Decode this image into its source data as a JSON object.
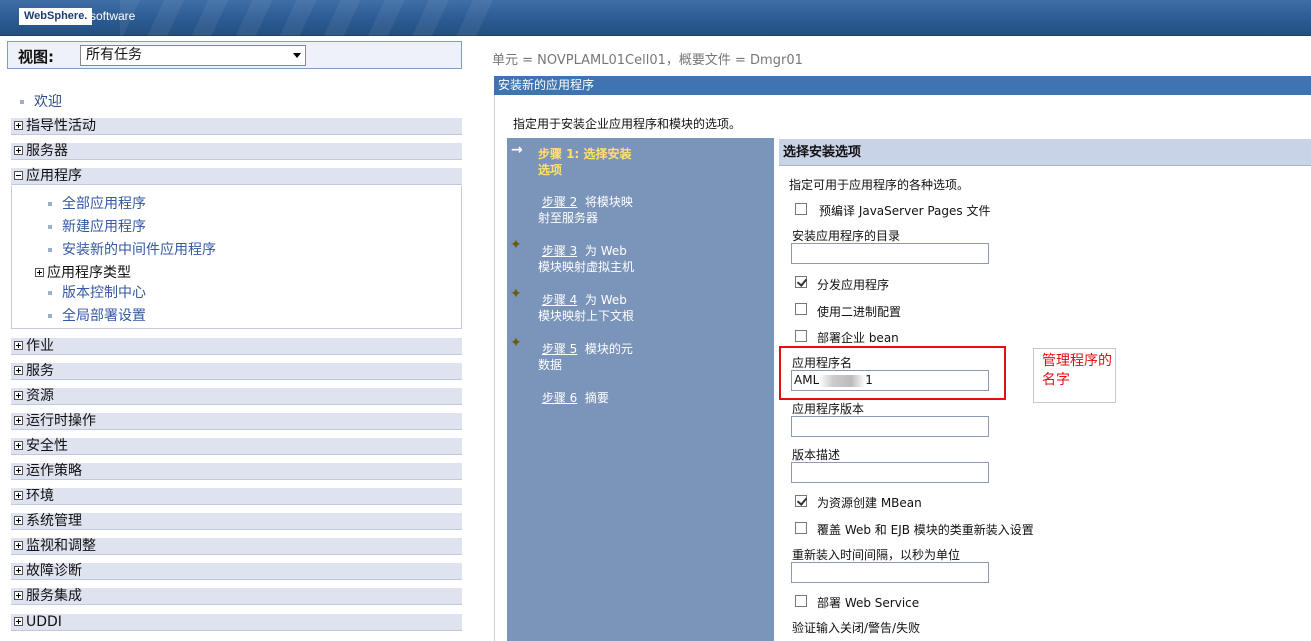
{
  "brand": {
    "logo": "WebSphere.",
    "sub": "software"
  },
  "nav": {
    "view_label": "视图:",
    "view_value": "所有任务",
    "welcome": "欢迎",
    "sections": {
      "guided": "指导性活动",
      "servers": "服务器",
      "applications": "应用程序",
      "jobs": "作业",
      "services": "服务",
      "resources": "资源",
      "runtime_ops": "运行时操作",
      "security": "安全性",
      "operational_policies": "运作策略",
      "environment": "环境",
      "system_admin": "系统管理",
      "monitoring": "监视和调整",
      "troubleshooting": "故障诊断",
      "service_integration": "服务集成",
      "uddi": "UDDI"
    },
    "app_children": {
      "all_apps": "全部应用程序",
      "new_app": "新建应用程序",
      "install_mw": "安装新的中间件应用程序",
      "app_types": "应用程序类型",
      "version_center": "版本控制中心",
      "global_deploy": "全局部署设置"
    }
  },
  "main": {
    "breadcrumb": "单元 = NOVPLAML01Cell01，概要文件 = Dmgr01",
    "panel_title": "安装新的应用程序",
    "intro": "指定用于安装企业应用程序和模块的选项。",
    "steps": {
      "s1": {
        "link": "步骤 1: 选择安装",
        "rest": "选项"
      },
      "s2": {
        "link": "步骤 2",
        "rest": "将模块映",
        "line2": "射至服务器"
      },
      "s3": {
        "link": "步骤 3",
        "rest": "为 Web",
        "line2": "模块映射虚拟主机"
      },
      "s4": {
        "link": "步骤 4",
        "rest": "为 Web",
        "line2": "模块映射上下文根"
      },
      "s5": {
        "link": "步骤 5",
        "rest": "模块的元",
        "line2": "数据"
      },
      "s6": {
        "link": "步骤 6",
        "rest": "摘要"
      }
    },
    "form": {
      "heading": "选择安装选项",
      "description": "指定可用于应用程序的各种选项。",
      "precompile_jsp": "预编译 JavaServer Pages 文件",
      "install_dir_label": "安装应用程序的目录",
      "distribute_app": "分发应用程序",
      "binary_config": "使用二进制配置",
      "deploy_ejb": "部署企业 bean",
      "app_name_label": "应用程序名",
      "app_name_prefix": "AML",
      "app_name_suffix": "1",
      "app_version_label": "应用程序版本",
      "version_desc_label": "版本描述",
      "create_mbean": "为资源创建 MBean",
      "override_reload": "覆盖 Web 和 EJB 模块的类重新装入设置",
      "reload_interval_label": "重新装入时间间隔，以秒为单位",
      "deploy_ws": "部署 Web Service",
      "validate_input": "验证输入关闭/警告/失败"
    },
    "annotation": "管理程序的名字"
  }
}
